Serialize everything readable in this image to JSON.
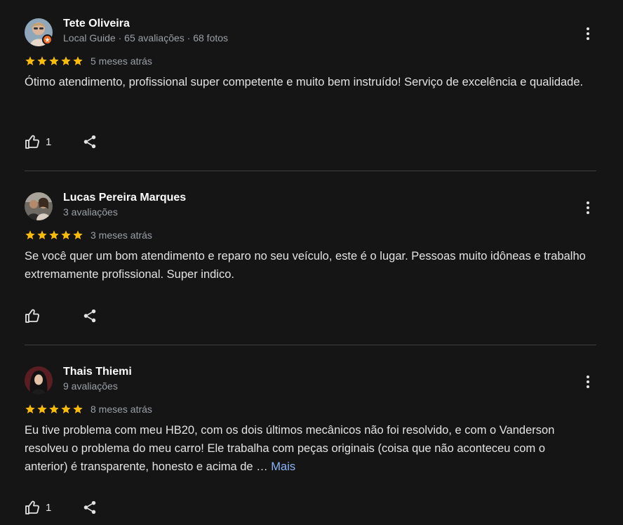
{
  "reviews": [
    {
      "name": "Tete Oliveira",
      "meta": "Local Guide · 65 avaliações · 68 fotos",
      "rating": 5,
      "age": "5 meses atrás",
      "text": "Ótimo atendimento, profissional super competente e muito bem instruído! Serviço de excelência e qualidade.",
      "more_link": "",
      "likes": "1",
      "local_guide": true
    },
    {
      "name": "Lucas Pereira Marques",
      "meta": "3 avaliações",
      "rating": 5,
      "age": "3 meses atrás",
      "text": "Se você quer um bom atendimento e reparo no seu veículo, este é o lugar. Pessoas muito idôneas e trabalho extremamente profissional. Super indico.",
      "more_link": "",
      "likes": "",
      "local_guide": false
    },
    {
      "name": "Thais Thiemi",
      "meta": "9 avaliações",
      "rating": 5,
      "age": "8 meses atrás",
      "text": "Eu tive problema com meu HB20, com os dois últimos mecânicos não foi resolvido, e com o Vanderson resolveu o problema do meu carro! Ele trabalha com peças originais (coisa que não aconteceu com o anterior) é transparente, honesto e acima de … ",
      "more_link": "Mais",
      "likes": "1",
      "local_guide": false
    }
  ],
  "colors": {
    "background": "#151515",
    "star": "#fbbc04",
    "link": "#8ab4f8",
    "secondary_text": "#9aa0a6",
    "divider": "#3c4043",
    "local_guide_badge": "#f36a2a"
  },
  "icons": {
    "more": "more-vert-icon",
    "like": "thumb-up-icon",
    "share": "share-icon",
    "star": "star-icon",
    "badge": "local-guide-badge-icon"
  }
}
